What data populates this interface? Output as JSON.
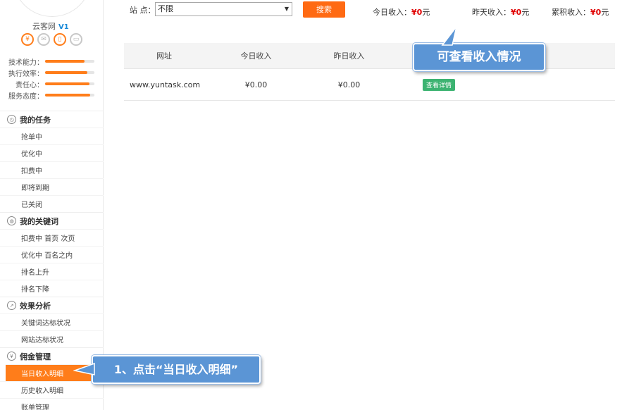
{
  "sidebar": {
    "site_name": "云客网",
    "vip_badge": "V1",
    "icons": [
      "money-icon",
      "mail-icon",
      "phone-icon",
      "card-icon"
    ],
    "skills": [
      {
        "label": "技术能力：",
        "level": 0.8
      },
      {
        "label": "执行效率：",
        "level": 0.85
      },
      {
        "label": "责任心：",
        "level": 0.9
      },
      {
        "label": "服务态度：",
        "level": 0.92
      }
    ],
    "menu": [
      {
        "title": "我的任务",
        "icon": "clock-icon",
        "items": [
          "抢单中",
          "优化中",
          "扣费中",
          "即将到期",
          "已关闭"
        ]
      },
      {
        "title": "我的关键词",
        "icon": "keyword-icon",
        "items": [
          "扣费中 首页 次页",
          "优化中 百名之内",
          "排名上升",
          "排名下降"
        ]
      },
      {
        "title": "效果分析",
        "icon": "chart-icon",
        "items": [
          "关键词达标状况",
          "网站达标状况"
        ]
      },
      {
        "title": "佣金管理",
        "icon": "yen-icon",
        "items": [
          "当日收入明细",
          "历史收入明细",
          "账单管理"
        ]
      }
    ],
    "active_item": "当日收入明细"
  },
  "filter": {
    "site_label": "站 点：",
    "site_value": "不限",
    "search_label": "搜索"
  },
  "stats": [
    {
      "label": "今日收入：",
      "value": "¥0",
      "unit": "元"
    },
    {
      "label": "昨天收入：",
      "value": "¥0",
      "unit": "元"
    },
    {
      "label": "累积收入：",
      "value": "¥0",
      "unit": "元"
    }
  ],
  "table": {
    "headers": [
      "网址",
      "今日收入",
      "昨日收入"
    ],
    "rows": [
      {
        "url": "www.yuntask.com",
        "today": "¥0.00",
        "yesterday": "¥0.00",
        "action": "查看详情"
      }
    ]
  },
  "callouts": {
    "top": "可查看收入情况",
    "bottom": "1、点击“当日收入明细”"
  },
  "colors": {
    "accent": "#ff6a13",
    "callout": "#5b95d5",
    "money": "#e00000",
    "detail_button": "#3cb371"
  }
}
